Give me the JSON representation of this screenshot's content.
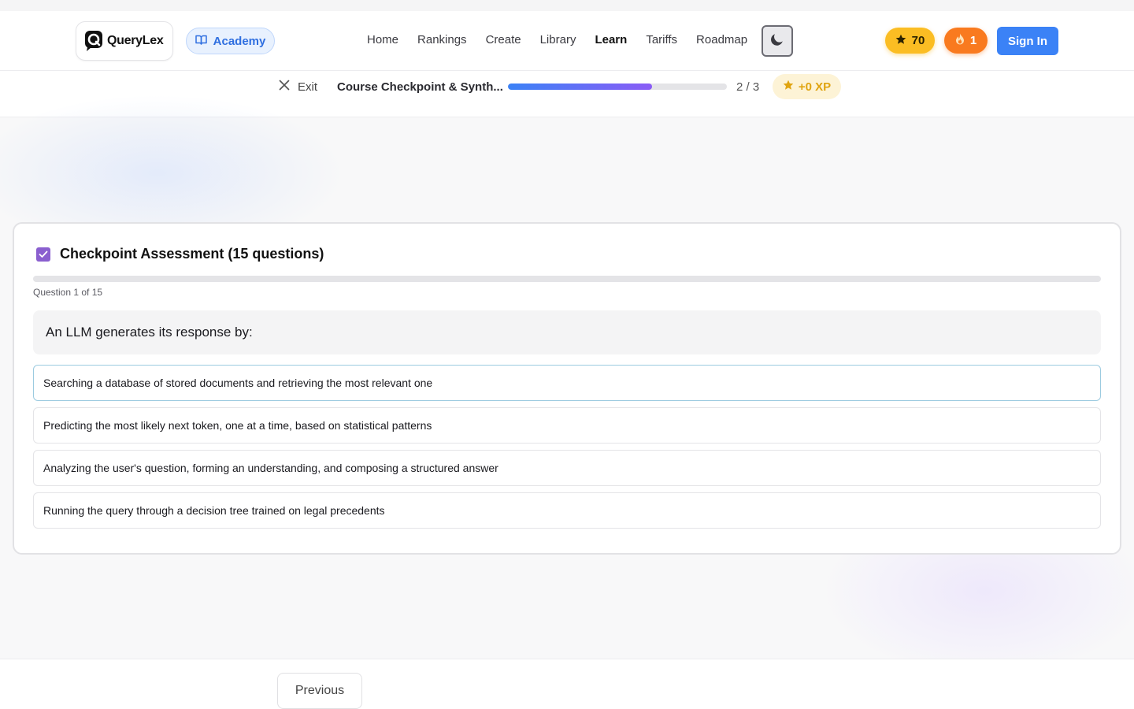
{
  "navbar": {
    "brand": "QueryLex",
    "academy_label": "Academy",
    "links": [
      {
        "label": "Home",
        "active": false
      },
      {
        "label": "Rankings",
        "active": false
      },
      {
        "label": "Create",
        "active": false
      },
      {
        "label": "Library",
        "active": false
      },
      {
        "label": "Learn",
        "active": true
      },
      {
        "label": "Tariffs",
        "active": false
      },
      {
        "label": "Roadmap",
        "active": false
      }
    ],
    "theme_icon": "moon-icon",
    "stars": "70",
    "streak": "1",
    "signin_label": "Sign In"
  },
  "lesson": {
    "exit_label": "Exit",
    "title": "Course Checkpoint & Synth...",
    "progress_fraction": 0.66,
    "count": "2 / 3",
    "xp": "+0 XP"
  },
  "assessment": {
    "title": "Checkpoint Assessment (15 questions)",
    "progress_fraction": 0,
    "question_count": "Question 1 of 15",
    "question": "An LLM generates its response by:",
    "options": [
      "Searching a database of stored documents and retrieving the most relevant one",
      "Predicting the most likely next token, one at a time, based on statistical patterns",
      "Analyzing the user's question, forming an understanding, and composing a structured answer",
      "Running the query through a decision tree trained on legal precedents"
    ]
  },
  "footer": {
    "previous_label": "Previous"
  },
  "colors": {
    "accent_blue": "#3b82f6",
    "accent_purple": "#8b5cf6",
    "star_yellow": "#fbbd23",
    "fire_orange": "#f97a1f"
  }
}
